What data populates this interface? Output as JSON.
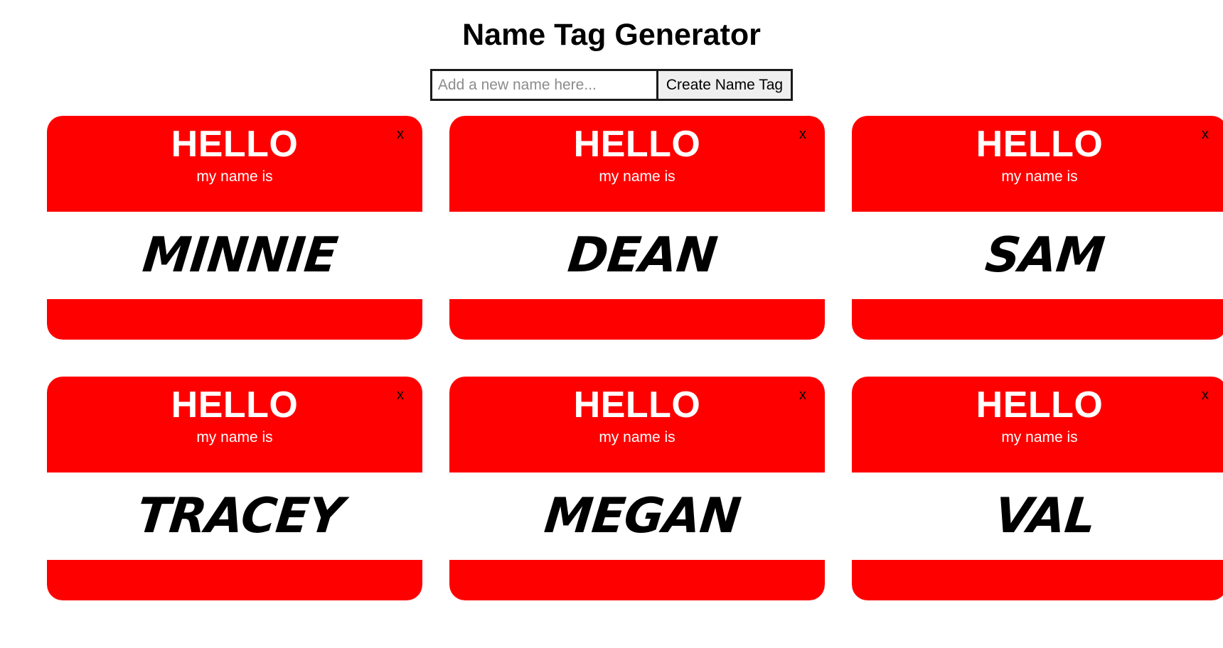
{
  "app": {
    "title": "Name Tag Generator"
  },
  "form": {
    "input_value": "",
    "input_placeholder": "Add a new name here...",
    "submit_label": "Create Name Tag"
  },
  "tag_template": {
    "greeting": "HELLO",
    "subtitle": "my name is",
    "close_label": "x"
  },
  "colors": {
    "tag_red": "#FF0000",
    "text_white": "#FFFFFF",
    "text_black": "#000000",
    "button_bg": "#EFEFEF",
    "placeholder": "#8C8C8C"
  },
  "tags": [
    {
      "name": "Minnie"
    },
    {
      "name": "Dean"
    },
    {
      "name": "Sam"
    },
    {
      "name": "Tracey"
    },
    {
      "name": "Megan"
    },
    {
      "name": "Val"
    }
  ]
}
